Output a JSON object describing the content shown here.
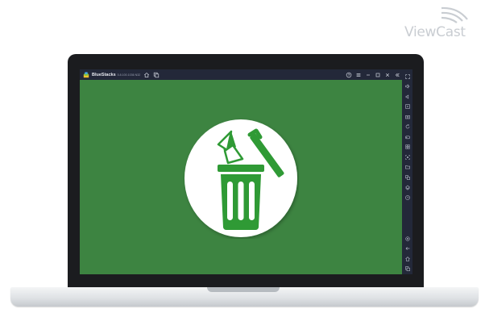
{
  "watermark": {
    "text": "ViewCast"
  },
  "window": {
    "title": "BlueStacks",
    "version": "5.8.100.1036 N32",
    "colors": {
      "titlebar": "#232839",
      "content": "#3d8441",
      "accent": "#3fa7f5"
    }
  },
  "titlebar": {
    "left_icons": [
      "home-icon",
      "multi-instance-icon"
    ],
    "right_icons": [
      "help-icon",
      "menu-icon",
      "minimize-icon",
      "maximize-icon",
      "close-icon",
      "collapse-sidebar-icon"
    ]
  },
  "sidebar": {
    "top_icons": [
      "fullscreen-icon",
      "volume-up-icon",
      "volume-down-icon",
      "media-icon",
      "screenshot-icon",
      "rotate-icon",
      "game-controls-icon",
      "macro-icon",
      "screen-record-icon",
      "folder-icon",
      "multi-instance-sync-icon",
      "eco-mode-icon",
      "replay-icon"
    ],
    "bottom_icons": [
      "settings-icon",
      "back-icon",
      "home-icon",
      "recent-apps-icon"
    ]
  },
  "app": {
    "icon": "trash-bin-icon",
    "colors": {
      "circle": "#ffffff",
      "bin": "#2f9a35"
    }
  }
}
